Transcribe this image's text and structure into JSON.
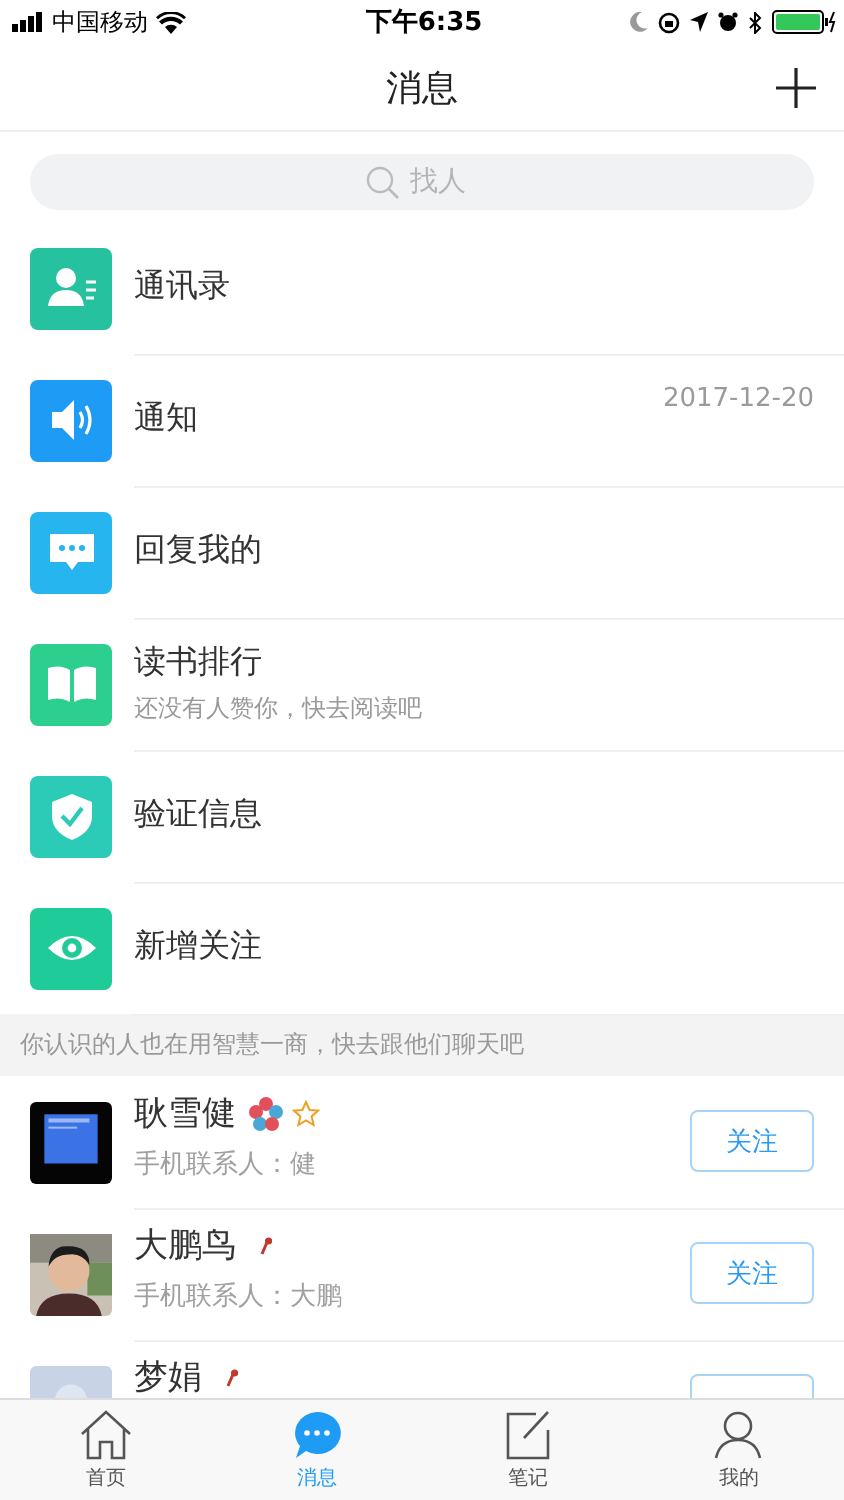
{
  "status_bar": {
    "carrier": "中国移动",
    "time": "下午6:35"
  },
  "nav_bar": {
    "title": "消息"
  },
  "search": {
    "placeholder": "找人"
  },
  "menu_items": [
    {
      "kind": "contacts",
      "color": "#26c2a0",
      "label": "通讯录"
    },
    {
      "kind": "notice",
      "color": "#1e9bf5",
      "label": "通知",
      "date": "2017-12-20"
    },
    {
      "kind": "reply",
      "color": "#27b5f0",
      "label": "回复我的"
    },
    {
      "kind": "reading",
      "color": "#2ccf8e",
      "label": "读书排行",
      "subtitle": "还没有人赞你，快去阅读吧"
    },
    {
      "kind": "verify",
      "color": "#2ccbb7",
      "label": "验证信息"
    },
    {
      "kind": "follow",
      "color": "#1fcb98",
      "label": "新增关注"
    }
  ],
  "suggest_banner": "你认识的人也在用智慧一商，快去跟他们聊天吧",
  "contacts": [
    {
      "avatar": {
        "kind": "picture"
      },
      "name": "耿雪健",
      "badges": [
        {
          "kind": "flower"
        },
        {
          "kind": "star"
        }
      ],
      "note": "手机联系人：健",
      "button": "关注"
    },
    {
      "avatar": {
        "kind": "picture"
      },
      "name": "大鹏鸟",
      "badges": [
        {
          "kind": "pin"
        }
      ],
      "note": "手机联系人：大鹏",
      "button": "关注"
    },
    {
      "avatar": {
        "kind": "default"
      },
      "name": "梦娟",
      "badges": [
        {
          "kind": "pin"
        }
      ]
    }
  ],
  "tab_bar": [
    {
      "kind": "home",
      "label": "首页",
      "selected": false
    },
    {
      "kind": "messages",
      "label": "消息",
      "selected": true
    },
    {
      "kind": "notes",
      "label": "笔记",
      "selected": false
    },
    {
      "kind": "profile",
      "label": "我的",
      "selected": false
    }
  ]
}
